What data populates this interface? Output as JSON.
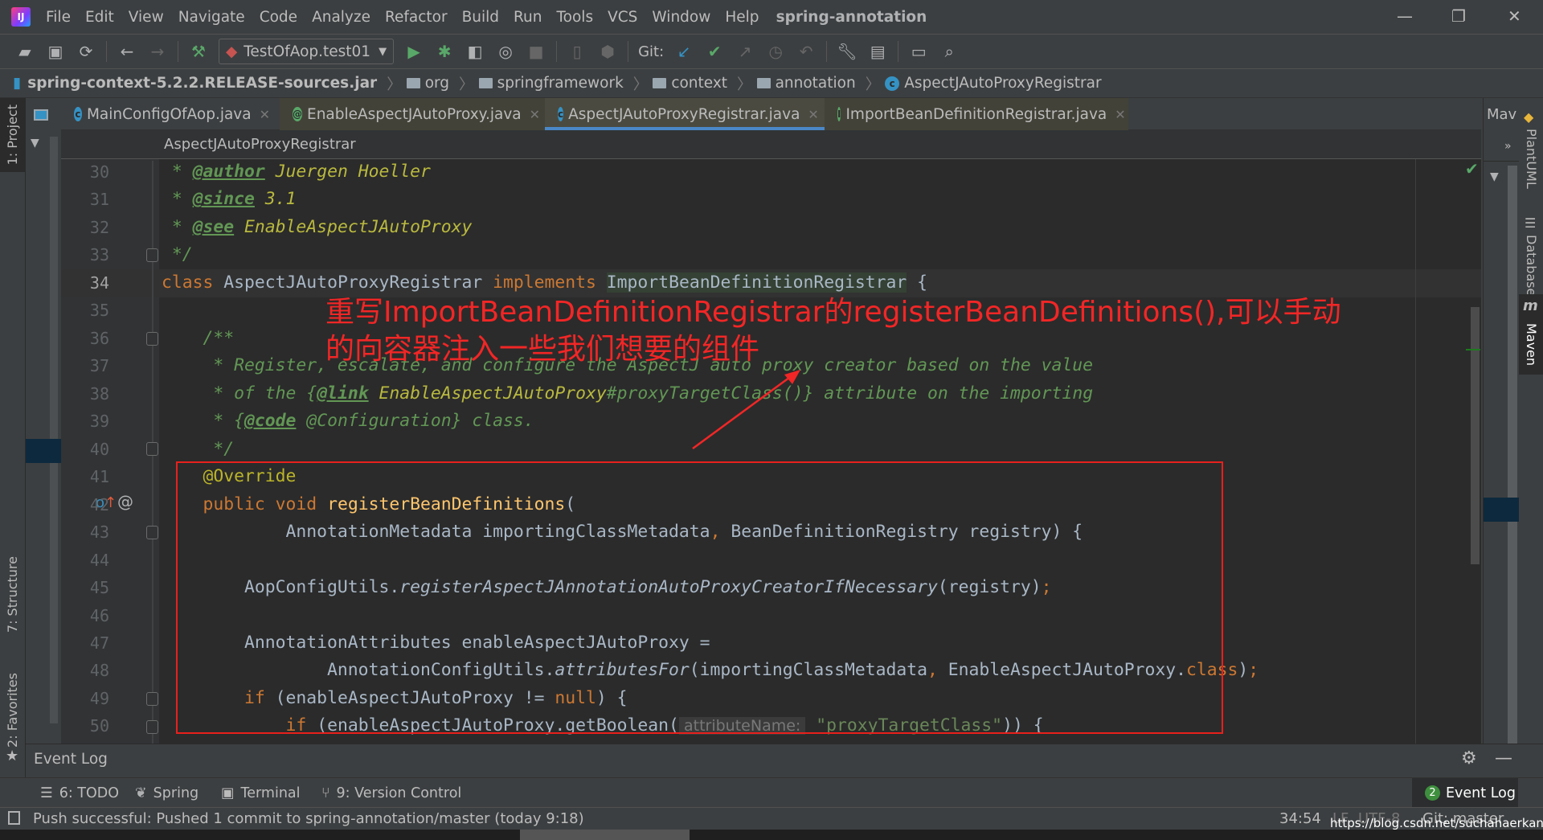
{
  "menubar": {
    "items": [
      "File",
      "Edit",
      "View",
      "Navigate",
      "Code",
      "Analyze",
      "Refactor",
      "Build",
      "Run",
      "Tools",
      "VCS",
      "Window",
      "Help"
    ],
    "project_title": "spring-annotation"
  },
  "toolbar": {
    "run_config": "TestOfAop.test01",
    "git_label": "Git:"
  },
  "navbar": {
    "crumbs": [
      "spring-context-5.2.2.RELEASE-sources.jar",
      "org",
      "springframework",
      "context",
      "annotation",
      "AspectJAutoProxyRegistrar"
    ]
  },
  "tabs": [
    {
      "label": "MainConfigOfAop.java",
      "icon": "C"
    },
    {
      "label": "EnableAspectJAutoProxy.java",
      "icon": "@"
    },
    {
      "label": "AspectJAutoProxyRegistrar.java",
      "icon": "C",
      "active": true
    },
    {
      "label": "ImportBeanDefinitionRegistrar.java",
      "icon": "I"
    }
  ],
  "tab_overflow_label": "Mav",
  "editor_breadcrumb": "AspectJAutoProxyRegistrar",
  "left_tools": {
    "project": "1: Project",
    "structure": "7: Structure",
    "favorites": "2: Favorites"
  },
  "right_tools": {
    "plantuml": "PlantUML",
    "database": "Database",
    "maven": "Maven"
  },
  "code_lines": [
    {
      "n": 30,
      "t": [
        [
          "c",
          " * "
        ],
        [
          "tag",
          "@author"
        ],
        [
          "jr",
          " Juergen Hoeller"
        ]
      ]
    },
    {
      "n": 31,
      "t": [
        [
          "c",
          " * "
        ],
        [
          "tag",
          "@since"
        ],
        [
          "jr",
          " 3.1"
        ]
      ]
    },
    {
      "n": 32,
      "t": [
        [
          "c",
          " * "
        ],
        [
          "tag",
          "@see"
        ],
        [
          "jr",
          " EnableAspectJAutoProxy"
        ]
      ]
    },
    {
      "n": 33,
      "t": [
        [
          "c",
          " */"
        ]
      ]
    },
    {
      "n": 34,
      "t": [
        [
          "k",
          "class "
        ],
        [
          "fr",
          "AspectJAutoProxyRegistrar "
        ],
        [
          "k",
          "implements "
        ],
        [
          "hl",
          "ImportBeanDefinitionRegistrar"
        ],
        [
          "fr",
          " {"
        ]
      ]
    },
    {
      "n": 35,
      "t": []
    },
    {
      "n": 36,
      "t": [
        [
          "c",
          "    /**"
        ]
      ]
    },
    {
      "n": 37,
      "t": [
        [
          "c",
          "     * Register, escalate, and configure the AspectJ auto proxy creator based on the value"
        ]
      ]
    },
    {
      "n": 38,
      "t": [
        [
          "c",
          "     * of the {"
        ],
        [
          "tag",
          "@link"
        ],
        [
          "jr",
          " EnableAspectJAutoProxy"
        ],
        [
          "c",
          "#proxyTargetClass()} attribute on the importing"
        ]
      ]
    },
    {
      "n": 39,
      "t": [
        [
          "c",
          "     * {"
        ],
        [
          "tag",
          "@code"
        ],
        [
          "c",
          " @Configuration} class."
        ]
      ]
    },
    {
      "n": 40,
      "t": [
        [
          "c",
          "     */"
        ]
      ]
    },
    {
      "n": 41,
      "t": [
        [
          "fr",
          "    "
        ],
        [
          "a",
          "@Override"
        ]
      ]
    },
    {
      "n": 42,
      "t": [
        [
          "k",
          "    public void "
        ],
        [
          "m",
          "registerBeanDefinitions"
        ],
        [
          "fr",
          "("
        ]
      ]
    },
    {
      "n": 43,
      "t": [
        [
          "fr",
          "            AnnotationMetadata importingClassMetadata"
        ],
        [
          "k",
          ", "
        ],
        [
          "fr",
          "BeanDefinitionRegistry registry) {"
        ]
      ]
    },
    {
      "n": 44,
      "t": []
    },
    {
      "n": 45,
      "t": [
        [
          "fr",
          "        AopConfigUtils."
        ],
        [
          "i",
          "registerAspectJAnnotationAutoProxyCreatorIfNecessary"
        ],
        [
          "fr",
          "(registry)"
        ],
        [
          "k",
          ";"
        ]
      ]
    },
    {
      "n": 46,
      "t": []
    },
    {
      "n": 47,
      "t": [
        [
          "fr",
          "        AnnotationAttributes enableAspectJAutoProxy ="
        ]
      ]
    },
    {
      "n": 48,
      "t": [
        [
          "fr",
          "                AnnotationConfigUtils."
        ],
        [
          "i",
          "attributesFor"
        ],
        [
          "fr",
          "(importingClassMetadata"
        ],
        [
          "k",
          ", "
        ],
        [
          "fr",
          "EnableAspectJAutoProxy."
        ],
        [
          "k",
          "class"
        ],
        [
          "fr",
          ")"
        ],
        [
          "k",
          ";"
        ]
      ]
    },
    {
      "n": 49,
      "t": [
        [
          "k",
          "        if "
        ],
        [
          "fr",
          "(enableAspectJAutoProxy != "
        ],
        [
          "k",
          "null"
        ],
        [
          "fr",
          ") {"
        ]
      ]
    },
    {
      "n": 50,
      "t": [
        [
          "k",
          "            if "
        ],
        [
          "fr",
          "(enableAspectJAutoProxy.getBoolean("
        ],
        [
          "h",
          " attributeName: "
        ],
        [
          "fr",
          " "
        ],
        [
          "s",
          "\"proxyTargetClass\""
        ],
        [
          "fr",
          ")) {"
        ]
      ]
    }
  ],
  "annotation": {
    "line1": "重写ImportBeanDefinitionRegistrar的registerBeanDefinitions(),可以手动",
    "line2": "的向容器注入一些我们想要的组件",
    "color": "#F22626"
  },
  "event_log_panel": {
    "title": "Event Log"
  },
  "bottom_tools": [
    {
      "label": "6: TODO",
      "icon": "list-icon"
    },
    {
      "label": "Spring",
      "icon": "spring-leaf-icon"
    },
    {
      "label": "Terminal",
      "icon": "terminal-icon"
    },
    {
      "label": "9: Version Control",
      "icon": "vcs-icon"
    }
  ],
  "event_log_button": {
    "label": "Event Log",
    "badge": "2"
  },
  "status": {
    "message": "Push successful: Pushed 1 commit to spring-annotation/master (today 9:18)",
    "position": "34:54",
    "line_sep": "LF",
    "encoding": "UTF-8",
    "git_branch": "Git: master",
    "watermark": "https://blog.csdn.net/suchahaerkang"
  }
}
